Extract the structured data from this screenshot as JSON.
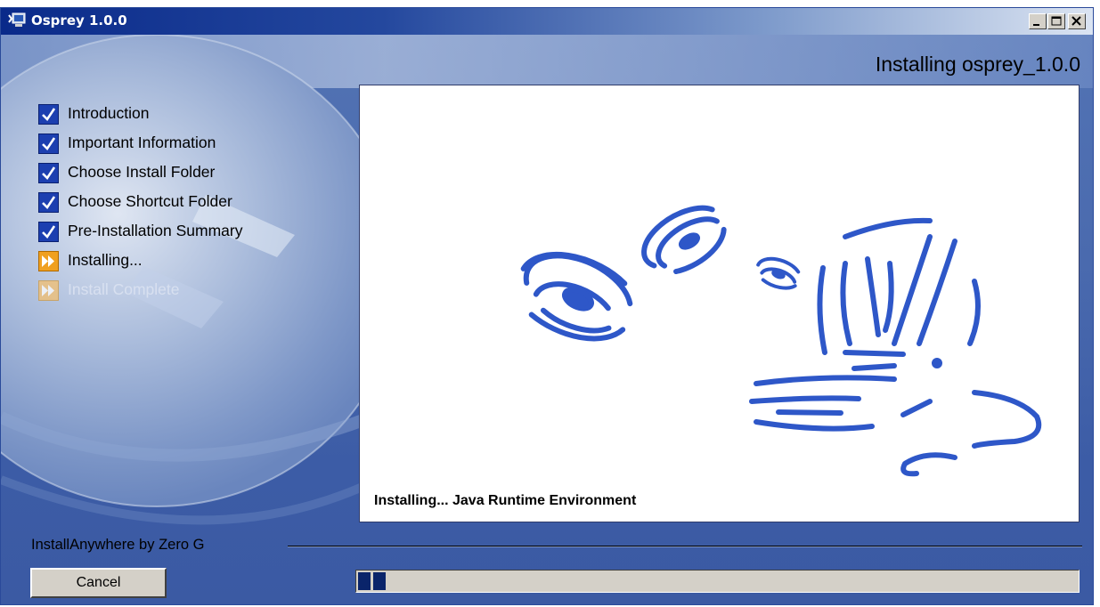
{
  "window": {
    "title": "Osprey 1.0.0",
    "controls": [
      "minimize-icon",
      "maximize-icon",
      "close-icon"
    ]
  },
  "header": {
    "title": "Installing osprey_1.0.0"
  },
  "steps": [
    {
      "label": "Introduction",
      "state": "done",
      "icon": "checkmark-icon"
    },
    {
      "label": "Important Information",
      "state": "done",
      "icon": "checkmark-icon"
    },
    {
      "label": "Choose Install Folder",
      "state": "done",
      "icon": "checkmark-icon"
    },
    {
      "label": "Choose Shortcut Folder",
      "state": "done",
      "icon": "checkmark-icon"
    },
    {
      "label": "Pre-Installation Summary",
      "state": "done",
      "icon": "checkmark-icon"
    },
    {
      "label": "Installing...",
      "state": "current",
      "icon": "arrow-forward-icon"
    },
    {
      "label": "Install Complete",
      "state": "pending",
      "icon": "arrow-forward-icon"
    }
  ],
  "panel": {
    "status": "Installing...  Java Runtime Environment"
  },
  "footer": {
    "brand": "InstallAnywhere by Zero G",
    "cancel_label": "Cancel",
    "progress_fraction": 0.04
  },
  "colors": {
    "titlebar_dark": "#0a2a8a",
    "background": "#4a6aae",
    "check_blue": "#1c3fb0",
    "arrow_orange": "#f0a020",
    "progress_blue": "#0a246a"
  }
}
